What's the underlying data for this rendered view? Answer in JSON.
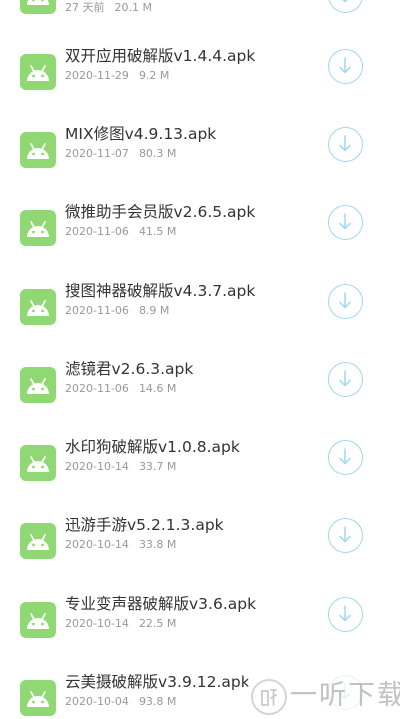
{
  "apps": [
    {
      "name": "",
      "date": "27 天前",
      "size": "20.1 M"
    },
    {
      "name": "双开应用破解版v1.4.4.apk",
      "date": "2020-11-29",
      "size": "9.2 M"
    },
    {
      "name": "MIX修图v4.9.13.apk",
      "date": "2020-11-07",
      "size": "80.3 M"
    },
    {
      "name": "微推助手会员版v2.6.5.apk",
      "date": "2020-11-06",
      "size": "41.5 M"
    },
    {
      "name": "搜图神器破解版v4.3.7.apk",
      "date": "2020-11-06",
      "size": "8.9 M"
    },
    {
      "name": "滤镜君v2.6.3.apk",
      "date": "2020-11-06",
      "size": "14.6 M"
    },
    {
      "name": "水印狗破解版v1.0.8.apk",
      "date": "2020-10-14",
      "size": "33.7 M"
    },
    {
      "name": "迅游手游v5.2.1.3.apk",
      "date": "2020-10-14",
      "size": "33.8 M"
    },
    {
      "name": "专业变声器破解版v3.6.apk",
      "date": "2020-10-14",
      "size": "22.5 M"
    },
    {
      "name": "云美摄破解版v3.9.12.apk",
      "date": "2020-10-04",
      "size": "93.8 M"
    }
  ],
  "icons": {
    "app": "android-icon",
    "download": "download-arrow-icon",
    "watermark_logo": "yiting-logo"
  },
  "colors": {
    "android_green": "#8fd873",
    "download_blue": "#9fd8f0",
    "name_text": "#333333",
    "meta_text": "#999999"
  },
  "watermark": {
    "text": "一听下载"
  }
}
